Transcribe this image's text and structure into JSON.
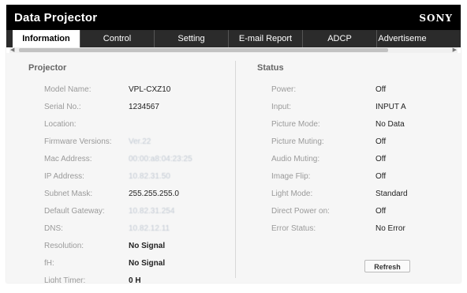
{
  "window": {
    "title": "Data Projector",
    "brand": "SONY"
  },
  "tabs": [
    {
      "label": "Information",
      "active": true
    },
    {
      "label": "Control"
    },
    {
      "label": "Setting"
    },
    {
      "label": "E-mail Report"
    },
    {
      "label": "ADCP"
    },
    {
      "label": "Advertiseme"
    }
  ],
  "projector": {
    "title": "Projector",
    "rows": [
      {
        "label": "Model Name:",
        "value": "VPL-CXZ10"
      },
      {
        "label": "Serial No.:",
        "value": "1234567"
      },
      {
        "label": "Location:",
        "value": ""
      },
      {
        "label": "Firmware Versions:",
        "value": "Ver.22"
      },
      {
        "label": "Mac Address:",
        "value": "00:00:a8:04:23:25"
      },
      {
        "label": "IP Address:",
        "value": "10.82.31.50"
      },
      {
        "label": "Subnet Mask:",
        "value": "255.255.255.0"
      },
      {
        "label": "Default Gateway:",
        "value": "10.82.31.254"
      },
      {
        "label": "DNS:",
        "value": "10.82.12.11"
      },
      {
        "label": "Resolution:",
        "value": "No Signal"
      },
      {
        "label": "fH:",
        "value": "No Signal"
      },
      {
        "label": "Light Timer:",
        "value": "0 H"
      }
    ]
  },
  "status": {
    "title": "Status",
    "rows": [
      {
        "label": "Power:",
        "value": "Off"
      },
      {
        "label": "Input:",
        "value": "INPUT A"
      },
      {
        "label": "Picture Mode:",
        "value": "No Data"
      },
      {
        "label": "Picture Muting:",
        "value": "Off"
      },
      {
        "label": "Audio Muting:",
        "value": "Off"
      },
      {
        "label": "Image Flip:",
        "value": "Off"
      },
      {
        "label": "Light Mode:",
        "value": "Standard"
      },
      {
        "label": "Direct Power on:",
        "value": "Off"
      },
      {
        "label": "Error Status:",
        "value": "No Error"
      }
    ],
    "refresh_label": "Refresh"
  }
}
